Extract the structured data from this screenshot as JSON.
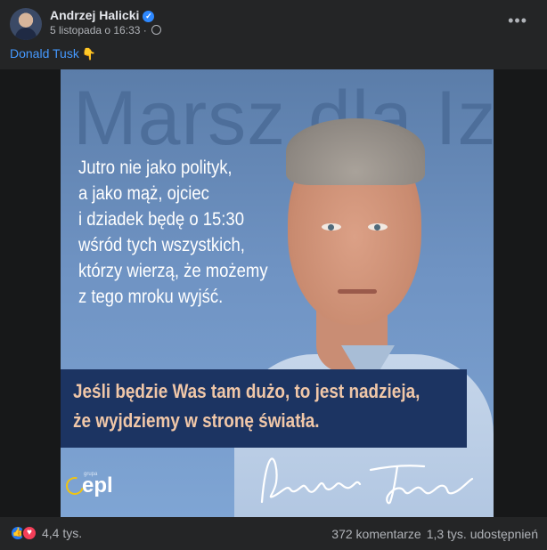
{
  "post": {
    "author": "Andrzej Halicki",
    "timestamp": "5 listopada o 16:33",
    "separator": " · ",
    "text_link": "Donald Tusk",
    "text_emoji": "👇",
    "more_label": "•••"
  },
  "poster": {
    "background_title": "Marsz dla Izy",
    "quote_lines": [
      "Jutro nie jako polityk,",
      "a jako mąż, ojciec",
      "i dziadek będę o 15:30",
      "wśród tych wszystkich,",
      "którzy wierzą, że możemy",
      "z tego mroku wyjść."
    ],
    "banner_lines": [
      "Jeśli będzie Was tam dużo, to jest nadzieja,",
      "że wyjdziemy w stronę światła."
    ],
    "logo_prefix": "grupa",
    "logo_text": "epl",
    "colors": {
      "background": "#6f93c3",
      "banner": "#1c3462",
      "banner_text": "#f0c7a8",
      "quote_text": "#ffffff"
    }
  },
  "footer": {
    "reaction_count": "4,4 tys.",
    "comments": "372 komentarze",
    "shares": "1,3 tys. udostępnień"
  },
  "icons": {
    "verified": "verified-badge-icon",
    "privacy": "globe-icon",
    "like": "like-icon",
    "love": "love-icon"
  }
}
